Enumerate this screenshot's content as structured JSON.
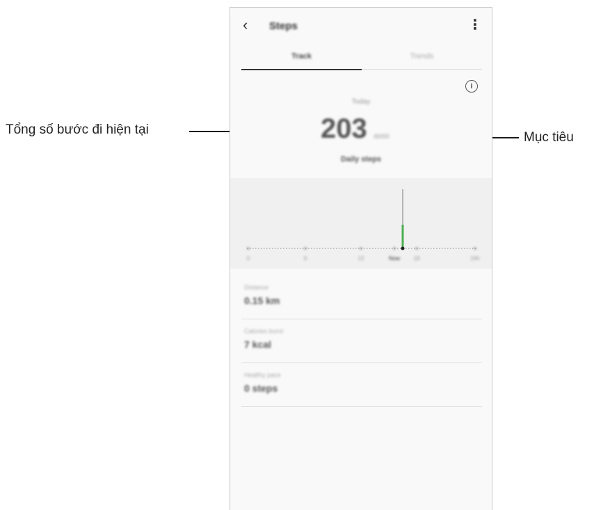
{
  "callouts": {
    "current_steps": "Tổng số bước đi hiện tại",
    "goal": "Mục tiêu"
  },
  "appbar": {
    "back_icon": "chevron-left-icon",
    "title": "Steps",
    "more_icon": "kebab-menu-icon"
  },
  "tabs": [
    {
      "label": "Track",
      "active": true
    },
    {
      "label": "Trends",
      "active": false
    }
  ],
  "summary": {
    "info_icon": "info-icon",
    "period": "Today",
    "steps": "203",
    "goal": "/6000",
    "caption": "Daily steps"
  },
  "chart_data": {
    "type": "bar",
    "x_ticks": [
      "0",
      "6",
      "12",
      "Now",
      "18",
      "24h"
    ],
    "accent_color": "#4caf50"
  },
  "stats": [
    {
      "label": "Distance",
      "value": "0.15 km"
    },
    {
      "label": "Calories burnt",
      "value": "7 kcal"
    },
    {
      "label": "Healthy pace",
      "value": "0 steps"
    }
  ]
}
